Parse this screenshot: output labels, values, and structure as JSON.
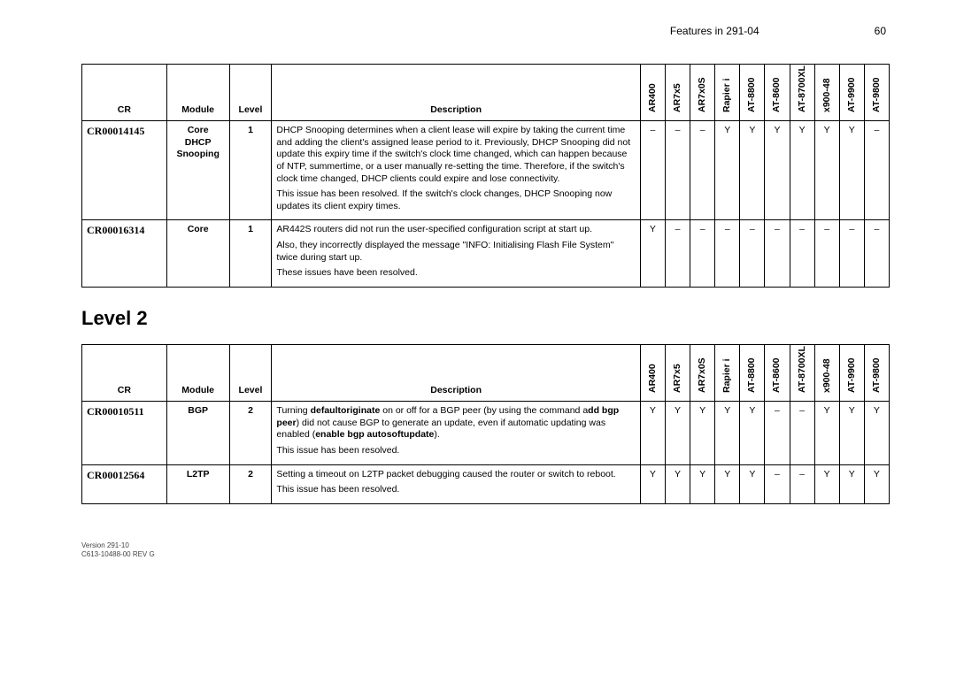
{
  "header": {
    "text": "Features in 291-04",
    "page": "60"
  },
  "cols": {
    "cr": "CR",
    "module": "Module",
    "level": "Level",
    "desc": "Description",
    "platforms": [
      "AR400",
      "AR7x5",
      "AR7x0S",
      "Rapier i",
      "AT-8800",
      "AT-8600",
      "AT-8700XL",
      "x900-48",
      "AT-9900",
      "AT-9800"
    ]
  },
  "section_heading": "Level 2",
  "table1": [
    {
      "cr": "CR00014145",
      "module": "Core\nDHCP\nSnooping",
      "level": "1",
      "desc": [
        "DHCP Snooping determines when a client lease will expire by taking the current time and adding the client's assigned lease period to it. Previously, DHCP Snooping did not update this expiry time if the switch's clock time changed, which can happen because of NTP, summertime, or a user manually re-setting the time. Therefore, if the switch's clock time changed, DHCP clients could expire and lose connectivity.",
        "This issue has been resolved. If the switch's clock changes, DHCP Snooping now updates its client expiry times."
      ],
      "plat": [
        "–",
        "–",
        "–",
        "Y",
        "Y",
        "Y",
        "Y",
        "Y",
        "Y",
        "–"
      ]
    },
    {
      "cr": "CR00016314",
      "module": "Core",
      "level": "1",
      "desc": [
        "AR442S routers did not run the user-specified configuration script at start up.",
        "Also, they incorrectly displayed the message \"INFO: Initialising Flash File System\" twice during start up.",
        "These issues have been resolved."
      ],
      "plat": [
        "Y",
        "–",
        "–",
        "–",
        "–",
        "–",
        "–",
        "–",
        "–",
        "–"
      ]
    }
  ],
  "table2": [
    {
      "cr": "CR00010511",
      "module": "BGP",
      "level": "2",
      "desc_parts": [
        {
          "t": "Turning "
        },
        {
          "t": "defaultoriginate",
          "b": true
        },
        {
          "t": " on or off for a BGP peer (by using the command a"
        },
        {
          "t": "dd bgp peer",
          "b": true
        },
        {
          "t": ") did not cause BGP to generate an update, even if automatic updating was enabled ("
        },
        {
          "t": "enable bgp autosoftupdate",
          "b": true
        },
        {
          "t": ")."
        }
      ],
      "desc_tail": "This issue has been resolved.",
      "plat": [
        "Y",
        "Y",
        "Y",
        "Y",
        "Y",
        "–",
        "–",
        "Y",
        "Y",
        "Y"
      ]
    },
    {
      "cr": "CR00012564",
      "module": "L2TP",
      "level": "2",
      "desc": [
        "Setting a timeout on L2TP packet debugging caused the router or switch to reboot.",
        "This issue has been resolved."
      ],
      "plat": [
        "Y",
        "Y",
        "Y",
        "Y",
        "Y",
        "–",
        "–",
        "Y",
        "Y",
        "Y"
      ]
    }
  ],
  "footer": {
    "l1": "Version 291-10",
    "l2": "C613-10488-00 REV G"
  }
}
